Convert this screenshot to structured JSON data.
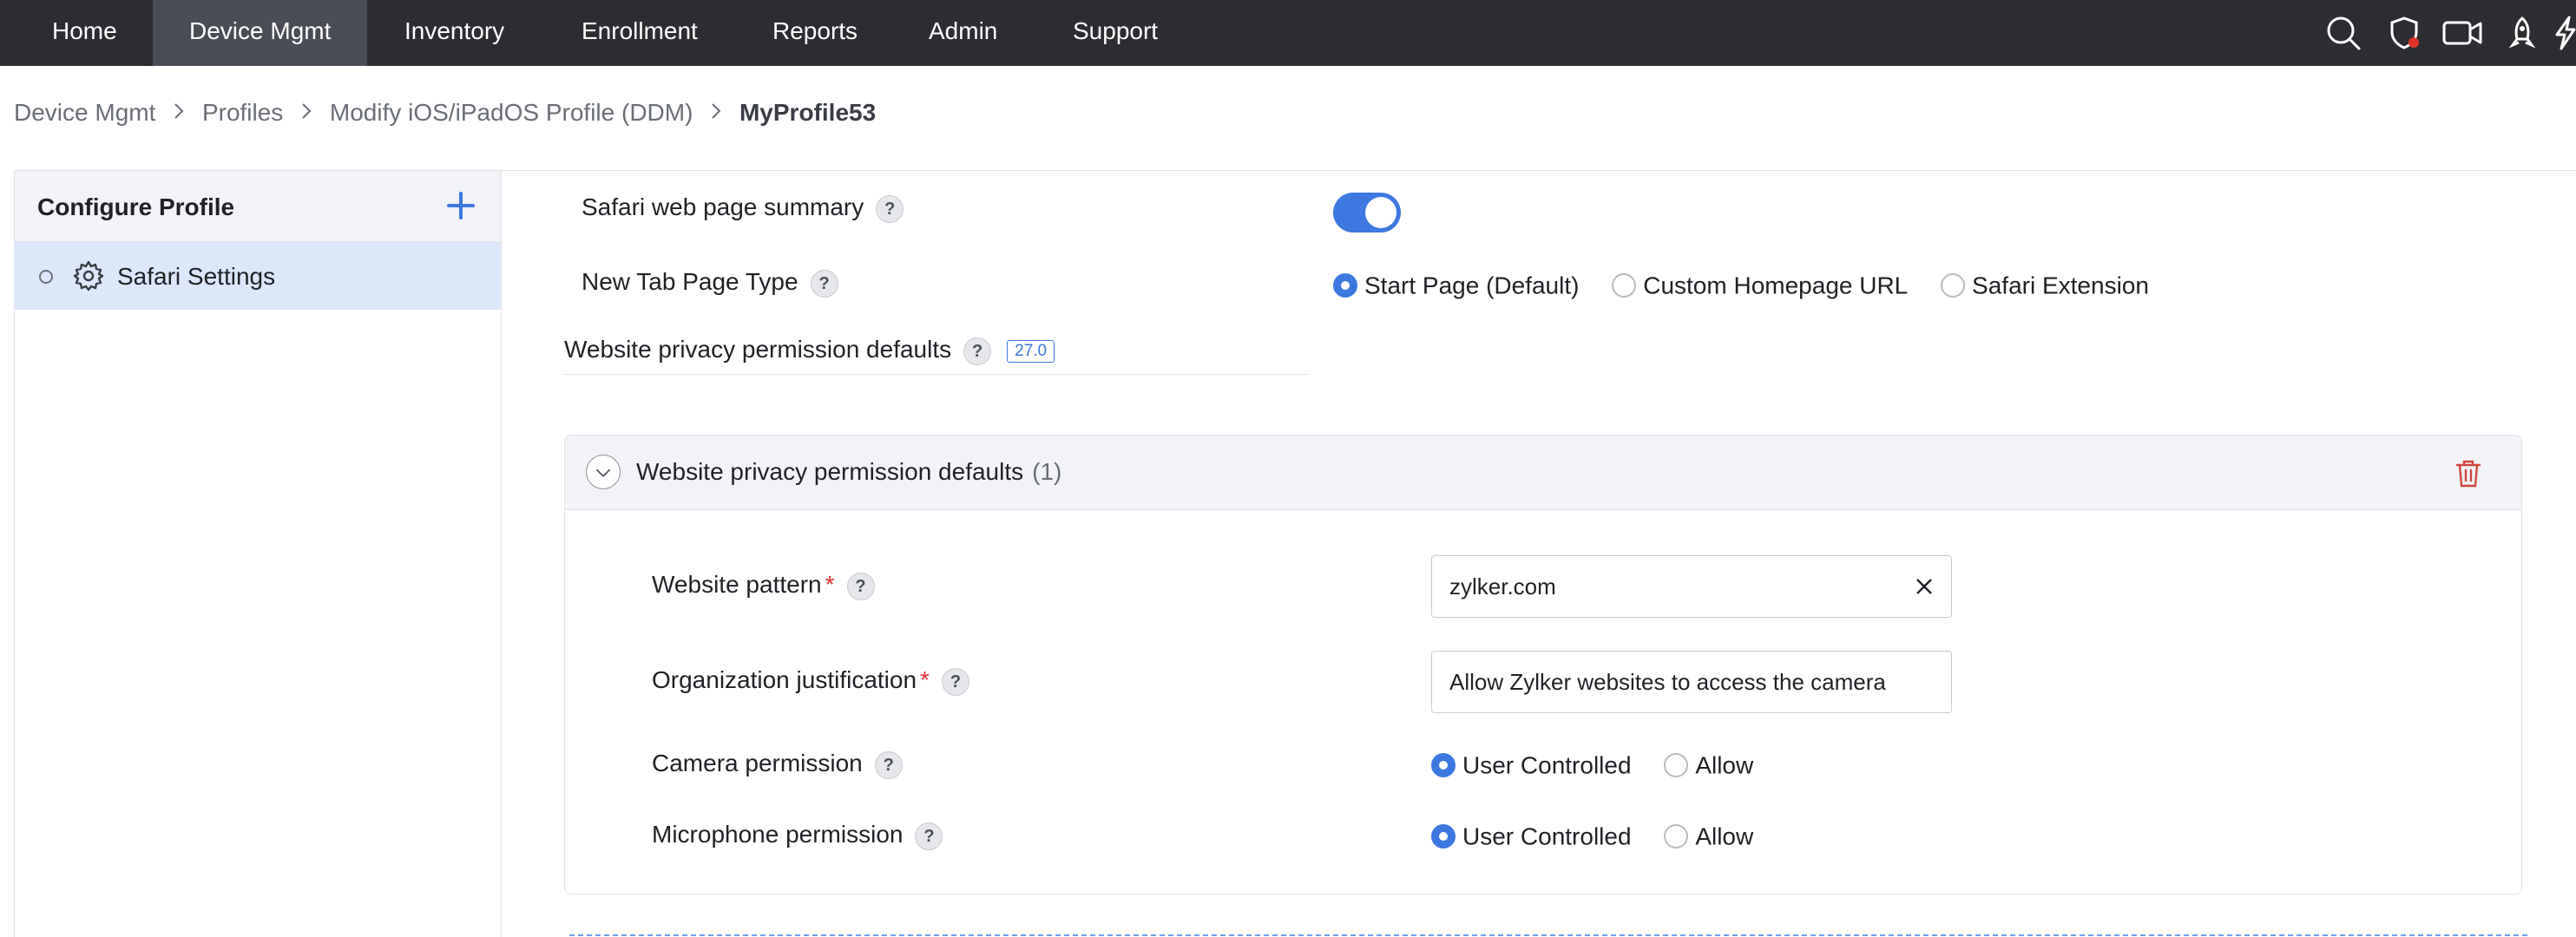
{
  "nav": {
    "tabs": [
      "Home",
      "Device Mgmt",
      "Inventory",
      "Enrollment",
      "Reports",
      "Admin",
      "Support"
    ],
    "active": "Device Mgmt",
    "icons": [
      "search-icon",
      "shield-alert-icon",
      "video-icon",
      "rocket-icon",
      "bolt-icon"
    ]
  },
  "breadcrumb": {
    "items": [
      "Device Mgmt",
      "Profiles",
      "Modify iOS/iPadOS Profile (DDM)"
    ],
    "current": "MyProfile53"
  },
  "sidebar": {
    "title": "Configure Profile",
    "items": [
      {
        "label": "Safari Settings",
        "icon": "gear-icon"
      }
    ]
  },
  "settings": {
    "web_page_summary": {
      "label": "Safari web page summary",
      "enabled": true
    },
    "new_tab": {
      "label": "New Tab Page Type",
      "options": [
        "Start Page (Default)",
        "Custom Homepage URL",
        "Safari Extension"
      ],
      "selected": "Start Page (Default)"
    },
    "privacy_defaults": {
      "label": "Website privacy permission defaults",
      "version_badge": "27.0"
    }
  },
  "section": {
    "title": "Website privacy permission defaults",
    "count": "(1)",
    "fields": {
      "website_pattern": {
        "label": "Website pattern",
        "required": "*",
        "value": "zylker.com"
      },
      "justification": {
        "label": "Organization justification",
        "required": "*",
        "value": "Allow Zylker websites to access the camera"
      },
      "camera": {
        "label": "Camera permission",
        "options": [
          "User Controlled",
          "Allow"
        ],
        "selected": "User Controlled"
      },
      "microphone": {
        "label": "Microphone permission",
        "options": [
          "User Controlled",
          "Allow"
        ],
        "selected": "User Controlled"
      }
    }
  },
  "help_glyph": "?",
  "colors": {
    "accent": "#3d78e0",
    "nav_bg": "#2b2d31",
    "required": "#e0322b",
    "delete": "#d0473f"
  }
}
